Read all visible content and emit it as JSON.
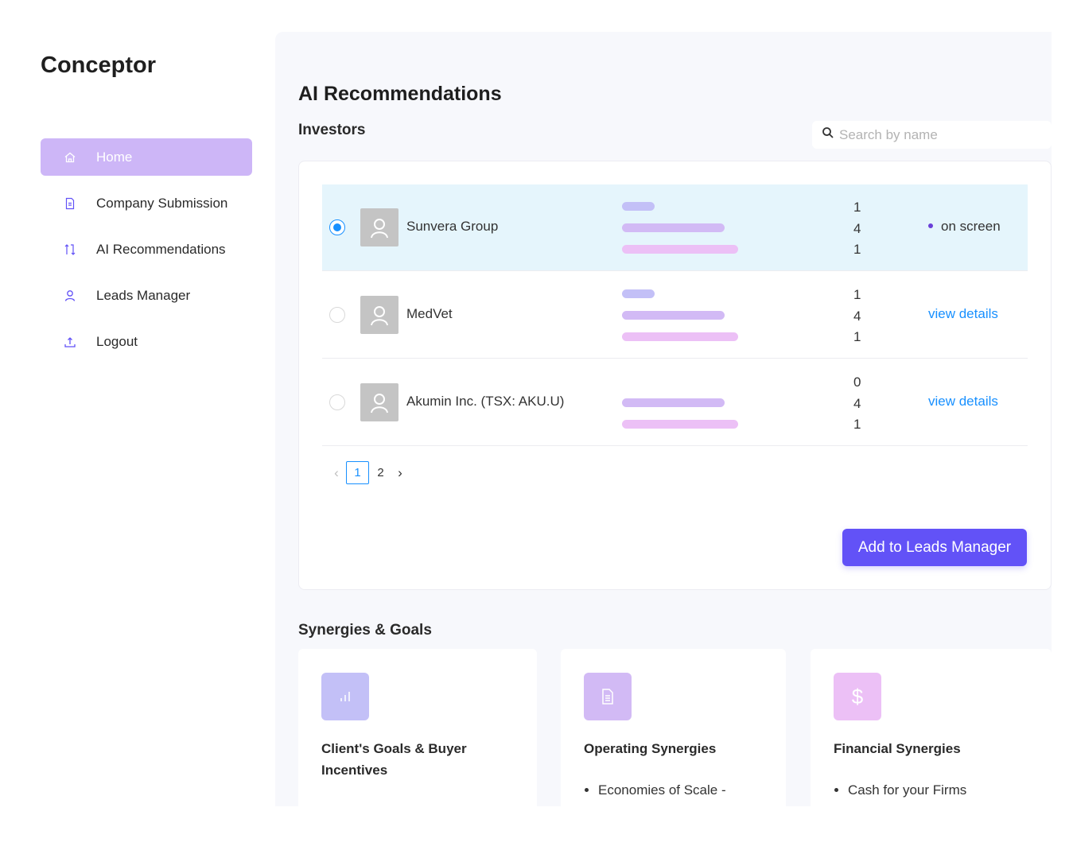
{
  "app": {
    "brand": "Conceptor"
  },
  "sidebar": {
    "items": [
      {
        "label": "Home",
        "icon": "home-icon",
        "active": true
      },
      {
        "label": "Company Submission",
        "icon": "document-icon",
        "active": false
      },
      {
        "label": "AI Recommendations",
        "icon": "pull-request-icon",
        "active": false
      },
      {
        "label": "Leads Manager",
        "icon": "user-icon",
        "active": false
      },
      {
        "label": "Logout",
        "icon": "upload-icon",
        "active": false
      }
    ]
  },
  "main": {
    "title": "AI Recommendations",
    "investors": {
      "heading": "Investors",
      "search": {
        "placeholder": "Search by name",
        "value": ""
      },
      "rows": [
        {
          "name": "Sunvera Group",
          "selected": true,
          "metrics": [
            1,
            4,
            1
          ],
          "action": "on screen",
          "action_type": "status"
        },
        {
          "name": "MedVet",
          "selected": false,
          "metrics": [
            1,
            4,
            1
          ],
          "action": "view details",
          "action_type": "link"
        },
        {
          "name": "Akumin Inc. (TSX: AKU.U)",
          "selected": false,
          "metrics": [
            0,
            4,
            1
          ],
          "action": "view details",
          "action_type": "link"
        }
      ],
      "bar_colors": [
        "#c3c0f7",
        "#d2baf5",
        "#ecc0f6"
      ],
      "pagination": {
        "pages": [
          "1",
          "2"
        ],
        "current": "1",
        "prev_icon": "chevron-left-icon",
        "next_icon": "chevron-right-icon"
      },
      "add_button": "Add to Leads Manager"
    },
    "synergies": {
      "heading": "Synergies & Goals",
      "cards": [
        {
          "title": "Client's Goals & Buyer Incentives",
          "icon": "bar-chart-icon",
          "icon_color": "#c3c0f7",
          "items": []
        },
        {
          "title": "Operating Synergies",
          "icon": "document-icon",
          "icon_color": "#d2baf5",
          "items": [
            "Economies of Scale -"
          ]
        },
        {
          "title": "Financial Synergies",
          "icon": "dollar-icon",
          "icon_color": "#ecc0f6",
          "items": [
            "Cash for your Firms"
          ]
        }
      ]
    }
  },
  "colors": {
    "accent": "#6252f7",
    "active_nav": "#cdb6f7",
    "selected_row": "#e5f5fc",
    "link": "#1890ff"
  }
}
